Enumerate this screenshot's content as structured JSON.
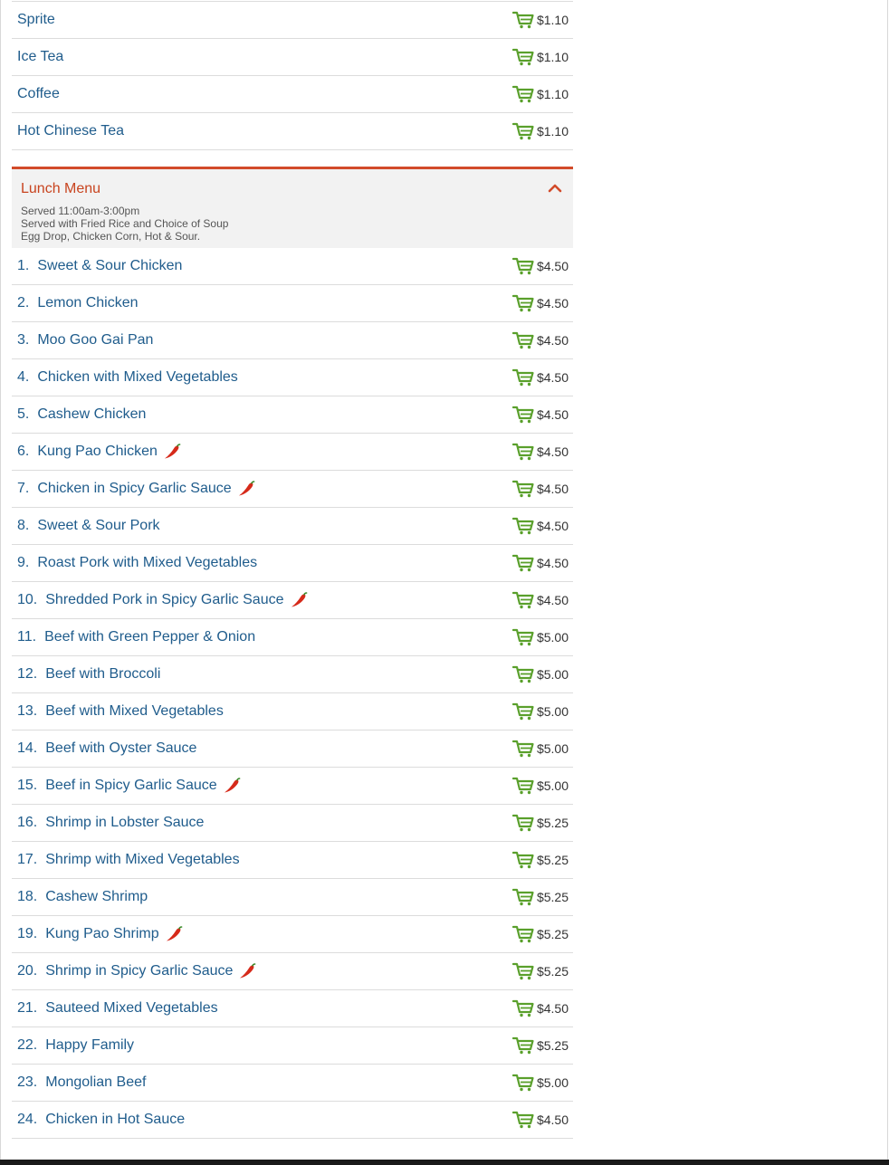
{
  "drinks": [
    {
      "name": "Sprite",
      "price": "$1.10"
    },
    {
      "name": "Ice Tea",
      "price": "$1.10"
    },
    {
      "name": "Coffee",
      "price": "$1.10"
    },
    {
      "name": "Hot Chinese Tea",
      "price": "$1.10"
    }
  ],
  "lunch": {
    "title": "Lunch Menu",
    "desc": [
      "Served 11:00am-3:00pm",
      "Served with Fried Rice and Choice of Soup",
      "Egg Drop, Chicken Corn, Hot & Sour."
    ],
    "items": [
      {
        "num": "1.",
        "name": "Sweet & Sour Chicken",
        "price": "$4.50",
        "spicy": false
      },
      {
        "num": "2.",
        "name": "Lemon Chicken",
        "price": "$4.50",
        "spicy": false
      },
      {
        "num": "3.",
        "name": "Moo Goo Gai Pan",
        "price": "$4.50",
        "spicy": false
      },
      {
        "num": "4.",
        "name": "Chicken with Mixed Vegetables",
        "price": "$4.50",
        "spicy": false
      },
      {
        "num": "5.",
        "name": "Cashew Chicken",
        "price": "$4.50",
        "spicy": false
      },
      {
        "num": "6.",
        "name": "Kung Pao Chicken",
        "price": "$4.50",
        "spicy": true
      },
      {
        "num": "7.",
        "name": "Chicken in Spicy Garlic Sauce",
        "price": "$4.50",
        "spicy": true
      },
      {
        "num": "8.",
        "name": "Sweet & Sour Pork",
        "price": "$4.50",
        "spicy": false
      },
      {
        "num": "9.",
        "name": "Roast Pork with Mixed Vegetables",
        "price": "$4.50",
        "spicy": false
      },
      {
        "num": "10.",
        "name": "Shredded Pork in Spicy Garlic Sauce",
        "price": "$4.50",
        "spicy": true
      },
      {
        "num": "11.",
        "name": "Beef with Green Pepper & Onion",
        "price": "$5.00",
        "spicy": false
      },
      {
        "num": "12.",
        "name": "Beef with Broccoli",
        "price": "$5.00",
        "spicy": false
      },
      {
        "num": "13.",
        "name": "Beef with Mixed Vegetables",
        "price": "$5.00",
        "spicy": false
      },
      {
        "num": "14.",
        "name": "Beef with Oyster Sauce",
        "price": "$5.00",
        "spicy": false
      },
      {
        "num": "15.",
        "name": "Beef in Spicy Garlic Sauce",
        "price": "$5.00",
        "spicy": true
      },
      {
        "num": "16.",
        "name": "Shrimp in Lobster Sauce",
        "price": "$5.25",
        "spicy": false
      },
      {
        "num": "17.",
        "name": "Shrimp with Mixed Vegetables",
        "price": "$5.25",
        "spicy": false
      },
      {
        "num": "18.",
        "name": "Cashew Shrimp",
        "price": "$5.25",
        "spicy": false
      },
      {
        "num": "19.",
        "name": "Kung Pao Shrimp",
        "price": "$5.25",
        "spicy": true
      },
      {
        "num": "20.",
        "name": "Shrimp in Spicy Garlic Sauce",
        "price": "$5.25",
        "spicy": true
      },
      {
        "num": "21.",
        "name": "Sauteed Mixed Vegetables",
        "price": "$4.50",
        "spicy": false
      },
      {
        "num": "22.",
        "name": "Happy Family",
        "price": "$5.25",
        "spicy": false
      },
      {
        "num": "23.",
        "name": "Mongolian Beef",
        "price": "$5.00",
        "spicy": false
      },
      {
        "num": "24.",
        "name": "Chicken in Hot Sauce",
        "price": "$4.50",
        "spicy": false
      }
    ]
  },
  "icons": {
    "cart": "add-to-cart-icon",
    "spicy": "chili-pepper-icon",
    "collapse": "chevron-up-icon"
  },
  "colors": {
    "item_text": "#1f5c8c",
    "section_accent": "#d24b2a",
    "cart_green": "#5aa02c",
    "chili_red": "#d62a1a"
  }
}
